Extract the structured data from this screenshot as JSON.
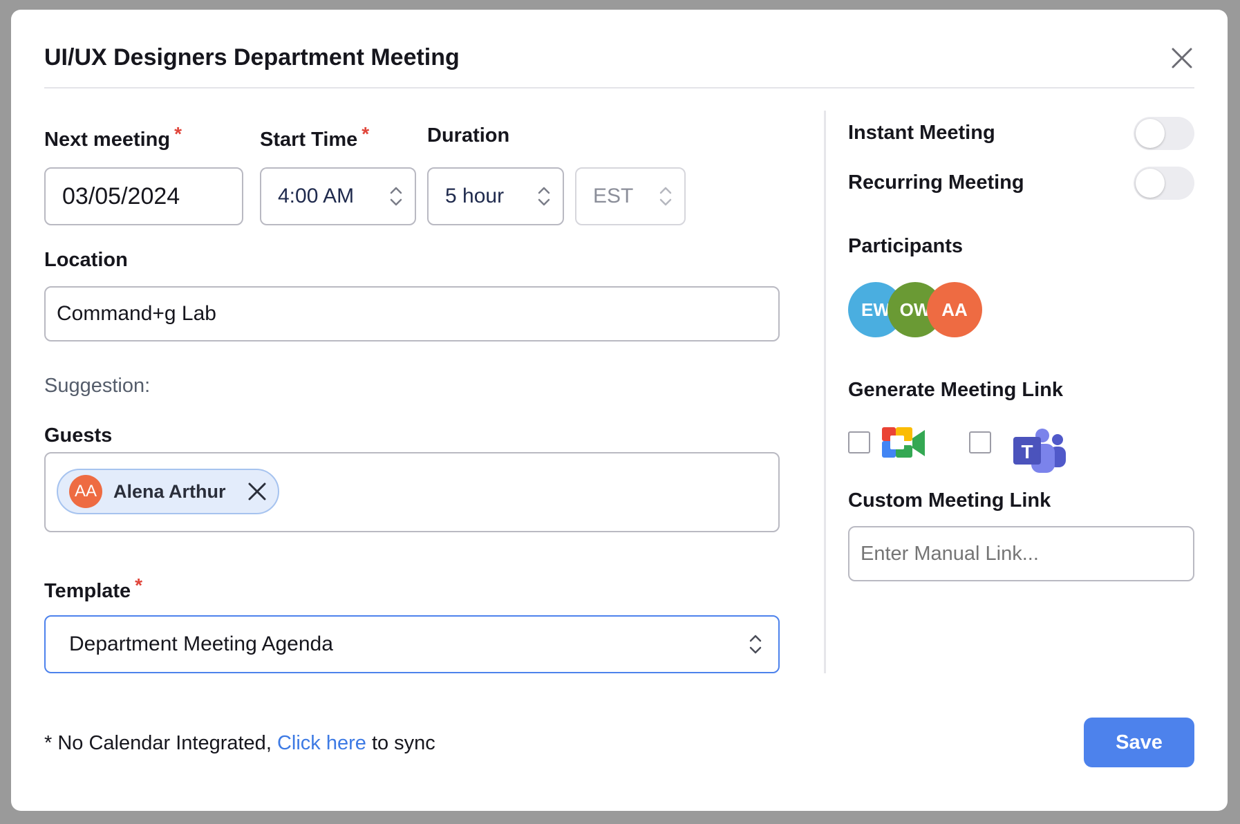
{
  "dialog": {
    "title": "UI/UX Designers Department Meeting"
  },
  "form": {
    "next_meeting": {
      "label": "Next meeting",
      "required": "*",
      "value": "03/05/2024"
    },
    "start_time": {
      "label": "Start Time",
      "required": "*",
      "value": "4:00 AM"
    },
    "duration": {
      "label": "Duration",
      "value": "5 hour"
    },
    "timezone": {
      "value": "EST"
    },
    "location": {
      "label": "Location",
      "value": "Command+g Lab"
    },
    "suggestion_label": "Suggestion:",
    "guests": {
      "label": "Guests",
      "items": [
        {
          "initials": "AA",
          "name": "Alena Arthur"
        }
      ]
    },
    "template": {
      "label": "Template",
      "required": "*",
      "value": "Department Meeting Agenda"
    }
  },
  "sidebar": {
    "instant_meeting": {
      "label": "Instant Meeting",
      "enabled": false
    },
    "recurring_meeting": {
      "label": "Recurring Meeting",
      "enabled": false
    },
    "participants": {
      "label": "Participants",
      "items": [
        {
          "initials": "EW",
          "color": "#4aaee0"
        },
        {
          "initials": "OW",
          "color": "#6a9a34"
        },
        {
          "initials": "AA",
          "color": "#ee6b42"
        }
      ]
    },
    "generate_link": {
      "label": "Generate Meeting Link",
      "options": [
        {
          "icon": "google-meet-icon",
          "checked": false
        },
        {
          "icon": "microsoft-teams-icon",
          "checked": false
        }
      ]
    },
    "custom_link": {
      "label": "Custom Meeting Link",
      "placeholder": "Enter Manual Link..."
    }
  },
  "footer": {
    "prefix": "* No Calendar Integrated,",
    "link": "Click here",
    "suffix": "to sync",
    "save_label": "Save"
  },
  "colors": {
    "primary": "#4d82ec",
    "link": "#3d7ae4",
    "required": "#e0453a",
    "chip_bg": "#e3ecfb"
  }
}
